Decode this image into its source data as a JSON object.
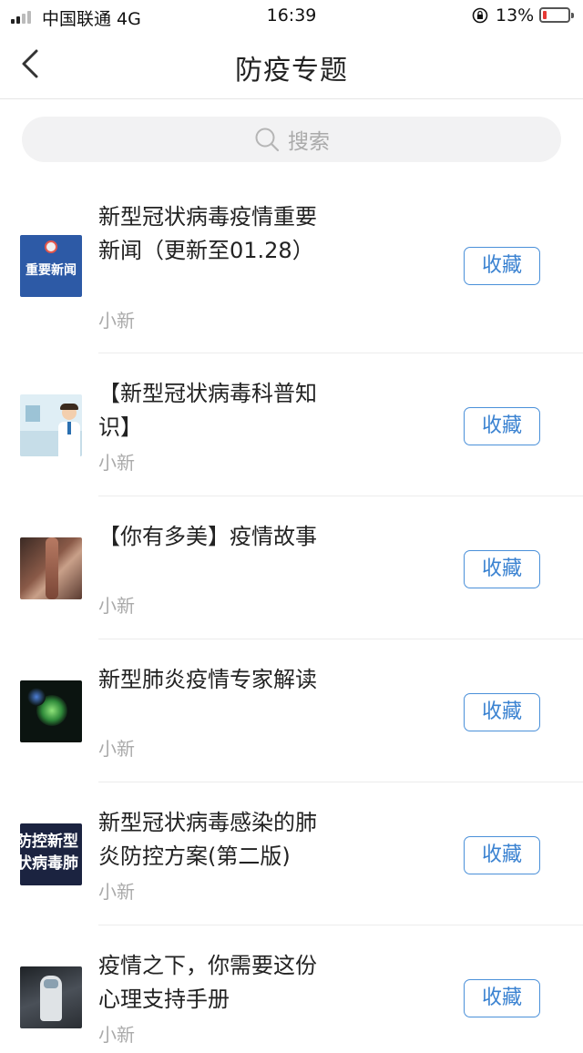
{
  "status_bar": {
    "carrier": "中国联通 4G",
    "time": "16:39",
    "battery_percent": "13%",
    "battery_level": 0.13,
    "battery_color": "#e53935"
  },
  "nav": {
    "title": "防疫专题",
    "back_icon": "chevron-left-icon"
  },
  "search": {
    "placeholder": "搜索",
    "icon": "search-icon"
  },
  "accent_color": "#3a82d1",
  "articles": [
    {
      "title": "新型冠状病毒疫情重要新闻（更新至01.28）",
      "source": "小新",
      "button": "收藏",
      "thumbnail_text": "重要新闻"
    },
    {
      "title": "【新型冠状病毒科普知识】",
      "source": "小新",
      "button": "收藏"
    },
    {
      "title": "【你有多美】疫情故事",
      "source": "小新",
      "button": "收藏"
    },
    {
      "title": "新型肺炎疫情专家解读",
      "source": "小新",
      "button": "收藏"
    },
    {
      "title": "新型冠状病毒感染的肺炎防控方案(第二版)",
      "source": "小新",
      "button": "收藏",
      "thumbnail_text": "防控新型 状病毒肺"
    },
    {
      "title": "疫情之下，你需要这份心理支持手册",
      "source": "小新",
      "button": "收藏"
    }
  ]
}
